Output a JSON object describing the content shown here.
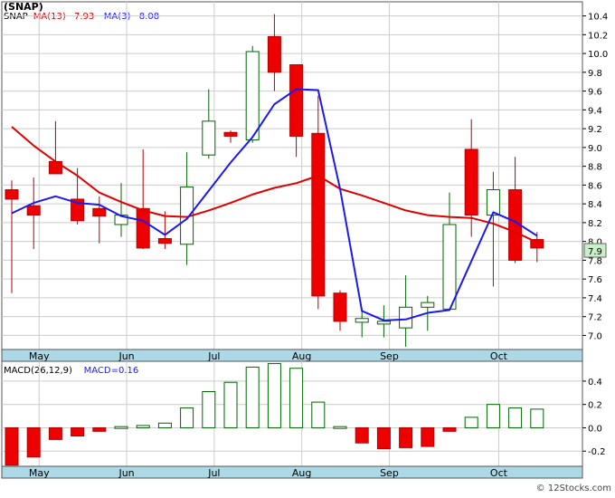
{
  "header": {
    "ticker_title": "(SNAP)",
    "legend": [
      {
        "text": "SNAP",
        "color": "#000000"
      },
      {
        "text": "MA(13)",
        "color": "#d40000"
      },
      {
        "text": "7.93",
        "color": "#d40000"
      },
      {
        "text": "MA(3)",
        "color": "#1a1aff"
      },
      {
        "text": "8.08",
        "color": "#1a1aff"
      }
    ]
  },
  "macd_header": {
    "legend": [
      {
        "text": "MACD(26,12,9)",
        "color": "#000000"
      },
      {
        "text": "MACD=0.16",
        "color": "#1a1aff"
      }
    ]
  },
  "watermark": "© 12Stocks.com",
  "chart_data": {
    "type": "candlestick",
    "price_axis": {
      "ticks": [
        7.0,
        7.2,
        7.4,
        7.6,
        7.8,
        8.0,
        8.2,
        8.4,
        8.6,
        8.8,
        9.0,
        9.2,
        9.4,
        9.6,
        9.8,
        10.0,
        10.2,
        10.4
      ],
      "range": [
        6.85,
        10.55
      ],
      "last_price_label": "7.9",
      "last_price": 7.9
    },
    "months": [
      "May",
      "Jun",
      "Jul",
      "Aug",
      "Sep",
      "Oct"
    ],
    "month_positions": [
      1.25,
      5.25,
      9.25,
      13.25,
      17.25,
      22.25
    ],
    "candles": [
      {
        "o": 8.55,
        "h": 8.65,
        "l": 7.45,
        "c": 8.45
      },
      {
        "o": 8.38,
        "h": 8.68,
        "l": 7.92,
        "c": 8.28
      },
      {
        "o": 8.85,
        "h": 9.28,
        "l": 8.78,
        "c": 8.72
      },
      {
        "o": 8.45,
        "h": 8.78,
        "l": 8.18,
        "c": 8.22
      },
      {
        "o": 8.35,
        "h": 8.48,
        "l": 7.98,
        "c": 8.27
      },
      {
        "o": 8.18,
        "h": 8.62,
        "l": 8.05,
        "c": 8.28
      },
      {
        "o": 8.35,
        "h": 8.98,
        "l": 7.92,
        "c": 7.93
      },
      {
        "o": 8.03,
        "h": 8.32,
        "l": 7.92,
        "c": 7.98
      },
      {
        "o": 7.97,
        "h": 8.95,
        "l": 7.75,
        "c": 8.58
      },
      {
        "o": 8.92,
        "h": 9.62,
        "l": 8.88,
        "c": 9.28
      },
      {
        "o": 9.16,
        "h": 9.18,
        "l": 9.05,
        "c": 9.12
      },
      {
        "o": 9.08,
        "h": 10.08,
        "l": 9.05,
        "c": 10.02
      },
      {
        "o": 10.18,
        "h": 10.42,
        "l": 9.6,
        "c": 9.8
      },
      {
        "o": 9.88,
        "h": 9.88,
        "l": 8.9,
        "c": 9.12
      },
      {
        "o": 9.15,
        "h": 9.55,
        "l": 7.28,
        "c": 7.42
      },
      {
        "o": 7.45,
        "h": 7.48,
        "l": 7.05,
        "c": 7.15
      },
      {
        "o": 7.14,
        "h": 7.28,
        "l": 6.98,
        "c": 7.18
      },
      {
        "o": 7.15,
        "h": 7.32,
        "l": 6.98,
        "c": 7.15
      },
      {
        "o": 7.08,
        "h": 7.64,
        "l": 6.88,
        "c": 7.3
      },
      {
        "o": 7.3,
        "h": 7.42,
        "l": 7.05,
        "c": 7.35
      },
      {
        "o": 7.28,
        "h": 8.52,
        "l": 7.28,
        "c": 8.18
      },
      {
        "o": 8.98,
        "h": 9.3,
        "l": 8.05,
        "c": 8.28
      },
      {
        "o": 8.28,
        "h": 8.74,
        "l": 7.52,
        "c": 8.55
      },
      {
        "o": 8.55,
        "h": 8.9,
        "l": 7.77,
        "c": 7.8
      },
      {
        "o": 8.02,
        "h": 8.1,
        "l": 7.78,
        "c": 7.93
      }
    ],
    "ma13": [
      9.22,
      9.02,
      8.85,
      8.7,
      8.52,
      8.42,
      8.33,
      8.27,
      8.26,
      8.33,
      8.41,
      8.5,
      8.57,
      8.62,
      8.7,
      8.56,
      8.49,
      8.41,
      8.33,
      8.28,
      8.26,
      8.25,
      8.19,
      8.1,
      7.99
    ],
    "ma3": [
      8.3,
      8.41,
      8.48,
      8.41,
      8.39,
      8.27,
      8.22,
      8.07,
      8.24,
      8.54,
      8.84,
      9.11,
      9.46,
      9.62,
      9.61,
      8.56,
      7.26,
      7.16,
      7.17,
      7.24,
      7.27,
      7.79,
      8.31,
      8.21,
      8.06
    ],
    "macd_axis": {
      "ticks": [
        -0.2,
        0.0,
        0.2,
        0.4
      ],
      "range": [
        -0.33,
        0.57
      ]
    },
    "macd": [
      -0.32,
      -0.25,
      -0.1,
      -0.07,
      -0.03,
      0.01,
      0.02,
      0.04,
      0.17,
      0.31,
      0.39,
      0.52,
      0.55,
      0.51,
      0.22,
      0.01,
      -0.13,
      -0.18,
      -0.17,
      -0.16,
      -0.03,
      0.09,
      0.2,
      0.17,
      0.16
    ]
  }
}
